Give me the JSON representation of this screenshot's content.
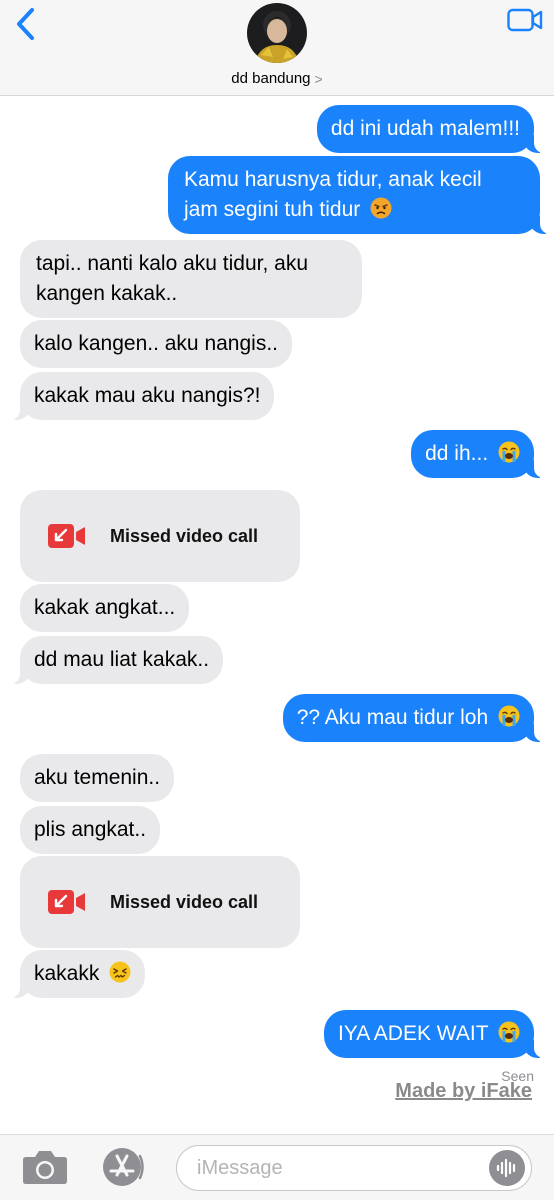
{
  "header": {
    "back_icon": "chevron-left-icon",
    "video_icon": "video-camera-icon",
    "contact_name": "dd bandung",
    "contact_chevron": ">"
  },
  "messages": [
    {
      "dir": "out",
      "text": "dd ini udah malem!!!"
    },
    {
      "dir": "out",
      "line1": "Kamu harusnya tidur, anak kecil",
      "line2": "jam segini tuh tidur",
      "emoji": "angry-face"
    },
    {
      "dir": "in",
      "line1": "tapi.. nanti kalo aku tidur, aku",
      "line2": "kangen kakak.."
    },
    {
      "dir": "in",
      "text": "kalo kangen.. aku nangis.."
    },
    {
      "dir": "in",
      "text": "kakak mau aku nangis?!"
    },
    {
      "dir": "out",
      "text": "dd ih...",
      "emoji": "loudly-crying-face"
    },
    {
      "dir": "in",
      "type": "missed-call",
      "text": "Missed video call"
    },
    {
      "dir": "in",
      "text": "kakak angkat..."
    },
    {
      "dir": "in",
      "text": "dd mau liat kakak.."
    },
    {
      "dir": "out",
      "text": "?? Aku mau tidur loh",
      "emoji": "loudly-crying-face"
    },
    {
      "dir": "in",
      "text": "aku temenin.."
    },
    {
      "dir": "in",
      "text": "plis angkat.."
    },
    {
      "dir": "in",
      "type": "missed-call",
      "text": "Missed video call"
    },
    {
      "dir": "in",
      "text": "kakakk",
      "emoji": "confounded-face"
    },
    {
      "dir": "out",
      "text": "IYA ADEK WAIT",
      "emoji": "loudly-crying-face"
    }
  ],
  "status": {
    "seen": "Seen",
    "watermark": "Made by iFake"
  },
  "inputbar": {
    "placeholder": "iMessage",
    "camera_icon": "camera-icon",
    "appstore_icon": "app-store-icon",
    "audio_icon": "audio-waveform-icon"
  },
  "colors": {
    "outgoing": "#1a82fb",
    "incoming": "#e9e9eb",
    "accent": "#1a82fb",
    "missed_call": "#e8393a"
  }
}
